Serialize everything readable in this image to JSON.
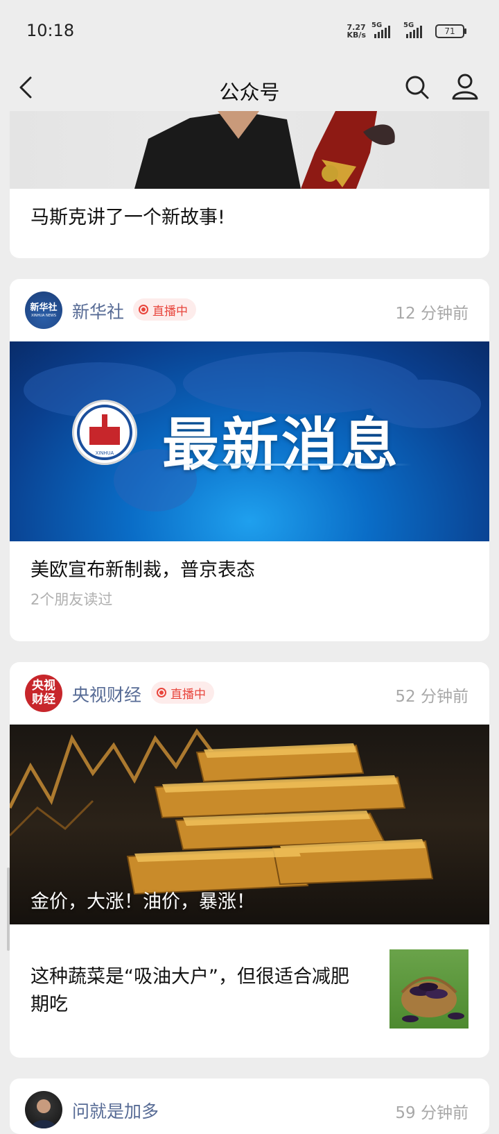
{
  "status": {
    "time": "10:18",
    "net_speed_value": "7.27",
    "net_speed_unit": "KB/s",
    "sim1": "5G",
    "sim2": "5G",
    "battery": "71"
  },
  "nav": {
    "title": "公众号",
    "back_icon": "chevron-left-icon",
    "search_icon": "search-icon",
    "profile_icon": "person-icon"
  },
  "cards": [
    {
      "title": "马斯克讲了一个新故事!"
    },
    {
      "account": "新华社",
      "avatar_text_top": "新华社",
      "avatar_text_bottom": "XINHUA NEWS",
      "live": "直播中",
      "time": "12 分钟前",
      "banner_text": "最新消息",
      "banner_logo_text": "XINHUA",
      "title": "美欧宣布新制裁，普京表态",
      "sub": "2个朋友读过"
    },
    {
      "account": "央视财经",
      "avatar_text_top": "央视",
      "avatar_text_bottom": "财经",
      "live": "直播中",
      "time": "52 分钟前",
      "hero_caption": "金价，大涨！油价，暴涨！",
      "title2": "这种蔬菜是“吸油大户”，但很适合减肥期吃"
    },
    {
      "account": "问就是加多",
      "time": "59 分钟前"
    }
  ],
  "colors": {
    "link": "#576b95",
    "live": "#e8453c",
    "bg": "#ededed"
  }
}
